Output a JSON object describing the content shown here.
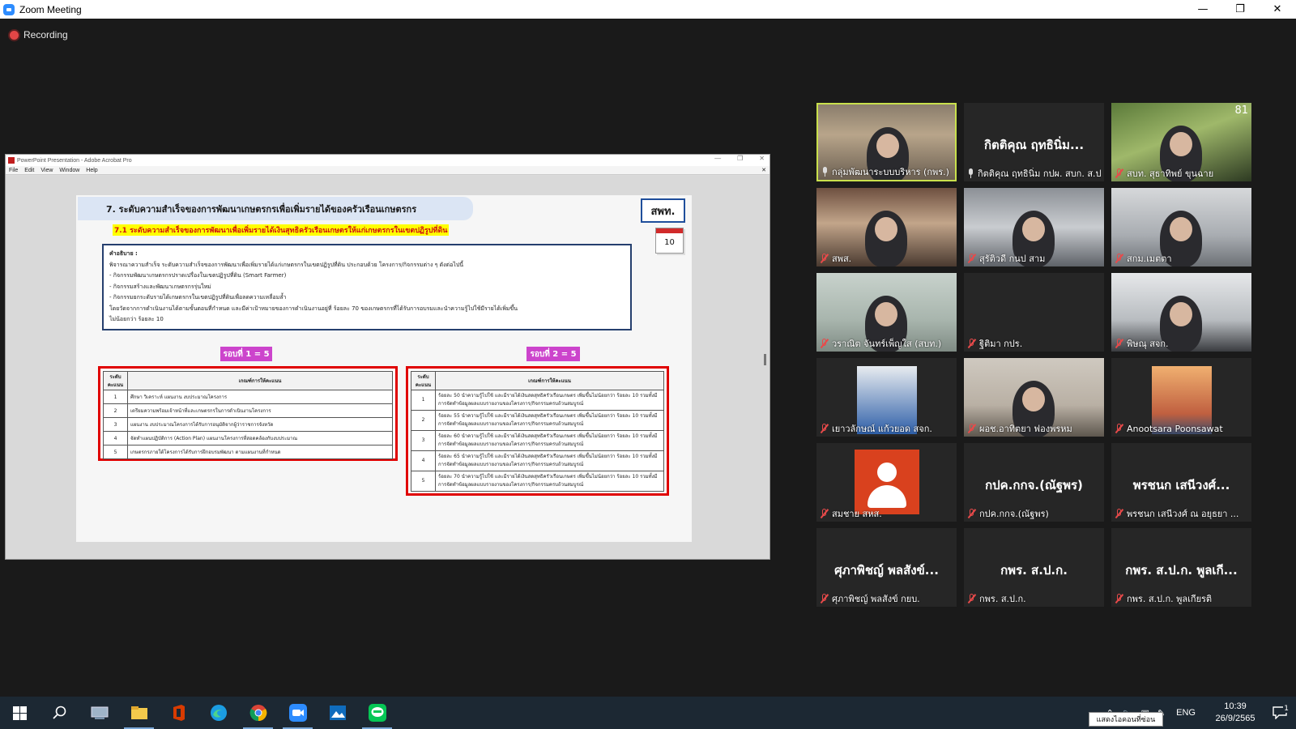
{
  "window": {
    "title": "Zoom Meeting"
  },
  "recording": {
    "label": "Recording"
  },
  "share": {
    "window_title": "PowerPoint Presentation - Adobe Acrobat Pro",
    "menu": [
      "File",
      "Edit",
      "View",
      "Window",
      "Help"
    ],
    "slide": {
      "title": "7. ระดับความสำเร็จของการพัฒนาเกษตรกรเพื่อเพิ่มรายได้ของครัวเรือนเกษตรกร",
      "org_badge": "สพท.",
      "page_number": "10",
      "subtitle": "7.1 ระดับความสำเร็จของการพัฒนาเพื่อเพิ่มรายได้เงินสุทธิครัวเรือนเกษตรให้แก่เกษตรกรในเขตปฏิรูปที่ดิน",
      "desc_heading": "คำอธิบาย :",
      "desc_lines": [
        "พิจารณาความสำเร็จ ระดับความสำเร็จของการพัฒนาเพื่อเพิ่มรายได้แก่เกษตรกรในเขตปฏิรูปที่ดิน ประกอบด้วย โครงการ/กิจกรรมต่าง ๆ ดังต่อไปนี้",
        "- กิจกรรมพัฒนาเกษตรกรปราดเปรื่องในเขตปฏิรูปที่ดิน (Smart Farmer)",
        "- กิจกรรมสร้างและพัฒนาเกษตรกรรุ่นใหม่",
        "- กิจกรรมยกระดับรายได้เกษตรกรในเขตปฏิรูปที่ดินเพื่อลดความเหลื่อมล้ำ",
        "โดยวัดจากการดำเนินงานได้ตามขั้นตอนที่กำหนด และมีค่าเป้าหมายของการดำเนินงานอยู่ที่ ร้อยละ 70 ของเกษตรกรที่ได้รับการอบรมและนำความรู้ไปใช้มีรายได้เพิ่มขึ้น",
        "ไม่น้อยกว่า ร้อยละ 10"
      ],
      "round1_label": "รอบที่ 1 = 5",
      "round2_label": "รอบที่ 2 = 5",
      "table_headers": [
        "ระดับคะแนน",
        "เกณฑ์การให้คะแนน"
      ],
      "round1_rows": [
        {
          "level": "1",
          "text": "ศึกษา วิเคราะห์ แผนงาน งบประมาณโครงการ"
        },
        {
          "level": "2",
          "text": "เตรียมความพร้อมเจ้าหน้าที่และเกษตรกรในการดำเนินงานโครงการ"
        },
        {
          "level": "3",
          "text": "แผนงาน งบประมาณโครงการได้รับการอนุมัติจากผู้ว่าราชการจังหวัด"
        },
        {
          "level": "4",
          "text": "จัดทำแผนปฏิบัติการ (Action Plan) แผนงานโครงการที่สอดคล้องกับงบประมาณ"
        },
        {
          "level": "5",
          "text": "เกษตรกรภายใต้โครงการได้รับการฝึกอบรมพัฒนา ตามแผนงานที่กำหนด"
        }
      ],
      "round2_rows": [
        {
          "level": "1",
          "text": "ร้อยละ 50 นำความรู้ไปใช้ และมีรายได้เงินสดสุทธิครัวเรือนเกษตร เพิ่มขึ้นไม่น้อยกว่า ร้อยละ 10 รวมทั้งมีการจัดทำข้อมูลผลแบบรายงานของโครงการ/กิจกรรมครบถ้วนสมบูรณ์"
        },
        {
          "level": "2",
          "text": "ร้อยละ 55 นำความรู้ไปใช้ และมีรายได้เงินสดสุทธิครัวเรือนเกษตร เพิ่มขึ้นไม่น้อยกว่า ร้อยละ 10 รวมทั้งมีการจัดทำข้อมูลผลแบบรายงานของโครงการ/กิจกรรมครบถ้วนสมบูรณ์"
        },
        {
          "level": "3",
          "text": "ร้อยละ 60 นำความรู้ไปใช้ และมีรายได้เงินสดสุทธิครัวเรือนเกษตร เพิ่มขึ้นไม่น้อยกว่า ร้อยละ 10 รวมทั้งมีการจัดทำข้อมูลผลแบบรายงานของโครงการ/กิจกรรมครบถ้วนสมบูรณ์"
        },
        {
          "level": "4",
          "text": "ร้อยละ 65 นำความรู้ไปใช้ และมีรายได้เงินสดสุทธิครัวเรือนเกษตร เพิ่มขึ้นไม่น้อยกว่า ร้อยละ 10 รวมทั้งมีการจัดทำข้อมูลผลแบบรายงานของโครงการ/กิจกรรมครบถ้วนสมบูรณ์"
        },
        {
          "level": "5",
          "text": "ร้อยละ 70 นำความรู้ไปใช้ และมีรายได้เงินสดสุทธิครัวเรือนเกษตร เพิ่มขึ้นไม่น้อยกว่า ร้อยละ 10 รวมทั้งมีการจัดทำข้อมูลผลแบบรายงานของโครงการ/กิจกรรมครบถ้วนสมบูรณ์"
        }
      ]
    }
  },
  "gallery": {
    "page_count": "81",
    "tiles": [
      {
        "label": "กลุ่มพัฒนาระบบบริหาร (กพร.)",
        "display": "",
        "muted": false,
        "active": true
      },
      {
        "label": "กิตติคุณ ฤทธินิ่ม กปผ. สบก. ส.ป...",
        "display": "กิตติคุณ ฤทธินิ่ม...",
        "muted": false,
        "active": false
      },
      {
        "label": "สบท. สุธาทิพย์ ขุนฉาย",
        "display": "",
        "muted": true,
        "active": false
      },
      {
        "label": "สพส.",
        "display": "",
        "muted": true,
        "active": false
      },
      {
        "label": "สุรัติวดี กนป สาม",
        "display": "",
        "muted": true,
        "active": false
      },
      {
        "label": "สกม.เมตตา",
        "display": "",
        "muted": true,
        "active": false
      },
      {
        "label": "วราณิต จันทร์เพ็ญใส (สบท.)",
        "display": "",
        "muted": true,
        "active": false
      },
      {
        "label": "ฐิติมา กปร.",
        "display": "",
        "muted": true,
        "active": false
      },
      {
        "label": "พิษณุ สจก.",
        "display": "",
        "muted": true,
        "active": false
      },
      {
        "label": "เยาวลักษณ์ แก้วยอด สจก.",
        "display": "",
        "muted": true,
        "active": false
      },
      {
        "label": "ผอช.อาทิตยา ฟองพรหม",
        "display": "",
        "muted": true,
        "active": false
      },
      {
        "label": "Anootsara Poonsawat",
        "display": "",
        "muted": true,
        "active": false
      },
      {
        "label": "สมชาย สหส.",
        "display": "",
        "muted": true,
        "active": false
      },
      {
        "label": "กปค.กกจ.(ณัฐพร)",
        "display": "กปค.กกจ.(ณัฐพร)",
        "muted": true,
        "active": false
      },
      {
        "label": "พรชนก เสนีวงศ์ ณ อยุธยา ...",
        "display": "พรชนก เสนีวงศ์...",
        "muted": true,
        "active": false
      },
      {
        "label": "ศุภาพิชญ์ พลสังข์ กยบ.",
        "display": "ศุภาพิชญ์ พลสังข์...",
        "muted": true,
        "active": false
      },
      {
        "label": "กพร. ส.ป.ก.",
        "display": "กพร. ส.ป.ก.",
        "muted": true,
        "active": false
      },
      {
        "label": "กพร. ส.ป.ก. พูลเกียรติ",
        "display": "กพร. ส.ป.ก. พูลเกี...",
        "muted": true,
        "active": false
      }
    ]
  },
  "taskbar": {
    "lang": "ENG",
    "time": "10:39",
    "date": "26/9/2565",
    "notifications": "1",
    "tooltip": "แสดงไอคอนที่ซ่อน"
  },
  "colors": {
    "zoom_blue": "#2D8CFF",
    "active_speaker": "#c9e04c",
    "mute_red": "#e84a4a",
    "highlight_red": "#e00000",
    "round_purple": "#cc44cc"
  }
}
